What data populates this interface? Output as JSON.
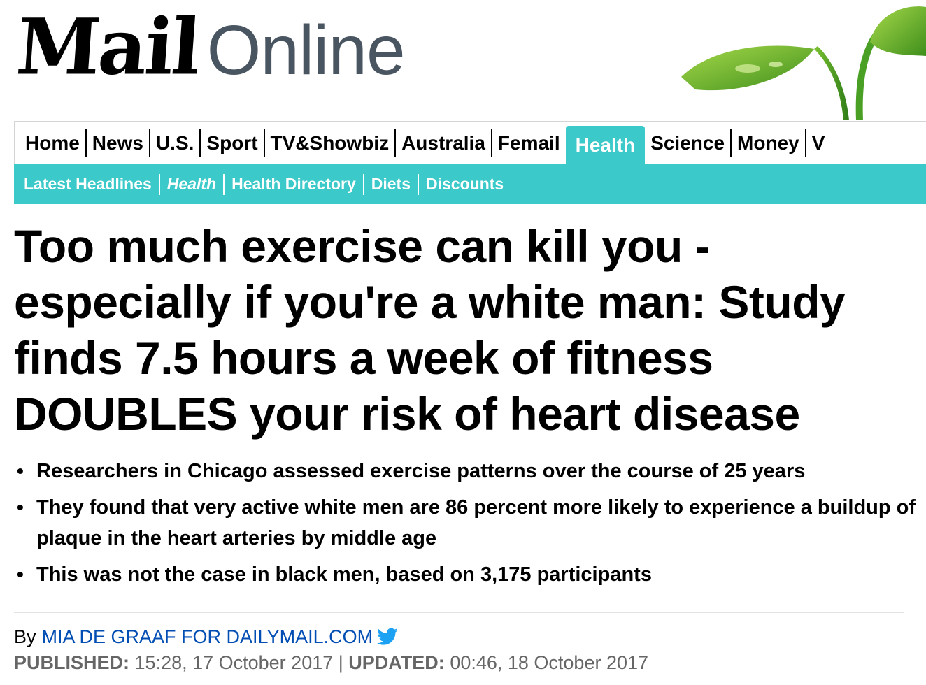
{
  "masthead": {
    "logo_mail": "Mail",
    "logo_online": "Online"
  },
  "nav": {
    "items": [
      {
        "label": "Home"
      },
      {
        "label": "News"
      },
      {
        "label": "U.S."
      },
      {
        "label": "Sport"
      },
      {
        "label": "TV&Showbiz"
      },
      {
        "label": "Australia"
      },
      {
        "label": "Femail"
      },
      {
        "label": "Health",
        "active": true
      },
      {
        "label": "Science"
      },
      {
        "label": "Money"
      },
      {
        "label": "V"
      }
    ]
  },
  "subnav": {
    "items": [
      {
        "label": "Latest Headlines"
      },
      {
        "label": "Health"
      },
      {
        "label": "Health Directory"
      },
      {
        "label": "Diets"
      },
      {
        "label": "Discounts"
      }
    ]
  },
  "article": {
    "headline": "Too much exercise can kill you - especially if you're a white man: Study finds 7.5 hours a week of fitness DOUBLES your risk of heart disease",
    "bullets": [
      "Researchers in Chicago assessed exercise patterns over the course of 25 years",
      "They found that very active white men are 86 percent more likely to experience a buildup of plaque in the heart arteries by middle age",
      "This was not the case in black men, based on 3,175 participants"
    ],
    "byline_prefix": "By",
    "author": "MIA DE GRAAF FOR DAILYMAIL.COM",
    "published_label": "PUBLISHED:",
    "published_value": "15:28, 17 October 2017",
    "separator": "|",
    "updated_label": "UPDATED:",
    "updated_value": "00:46, 18 October 2017"
  },
  "colors": {
    "accent": "#3cc9c9",
    "link": "#004db3",
    "logo_online": "#4a5562"
  }
}
